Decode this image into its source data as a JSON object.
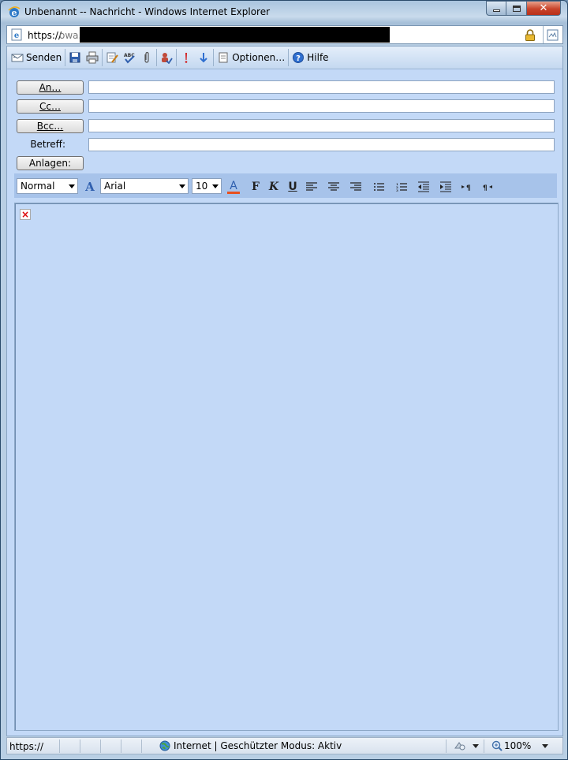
{
  "window": {
    "title": "Unbenannt -- Nachricht - Windows Internet Explorer"
  },
  "address": {
    "scheme": "https://",
    "host_visible": "owa."
  },
  "toolbar": {
    "send_label": "Senden",
    "options_label": "Optionen…",
    "help_label": "Hilfe"
  },
  "header": {
    "to_label": "An…",
    "cc_label": "Cc…",
    "bcc_label": "Bcc…",
    "subject_label": "Betreff:",
    "attachments_label": "Anlagen:",
    "to_value": "",
    "cc_value": "",
    "bcc_value": "",
    "subject_value": ""
  },
  "format": {
    "style": "Normal",
    "font": "Arial",
    "size": "10",
    "bold_glyph": "F",
    "italic_glyph": "K",
    "underline_glyph": "U"
  },
  "status": {
    "url": "https://",
    "zone": "Internet | Geschützter Modus: Aktiv",
    "zoom": "100%"
  },
  "colors": {
    "content_bg": "#c3d9f7",
    "format_bar": "#a7c3ea",
    "font_color_accent": "#e8501e"
  }
}
